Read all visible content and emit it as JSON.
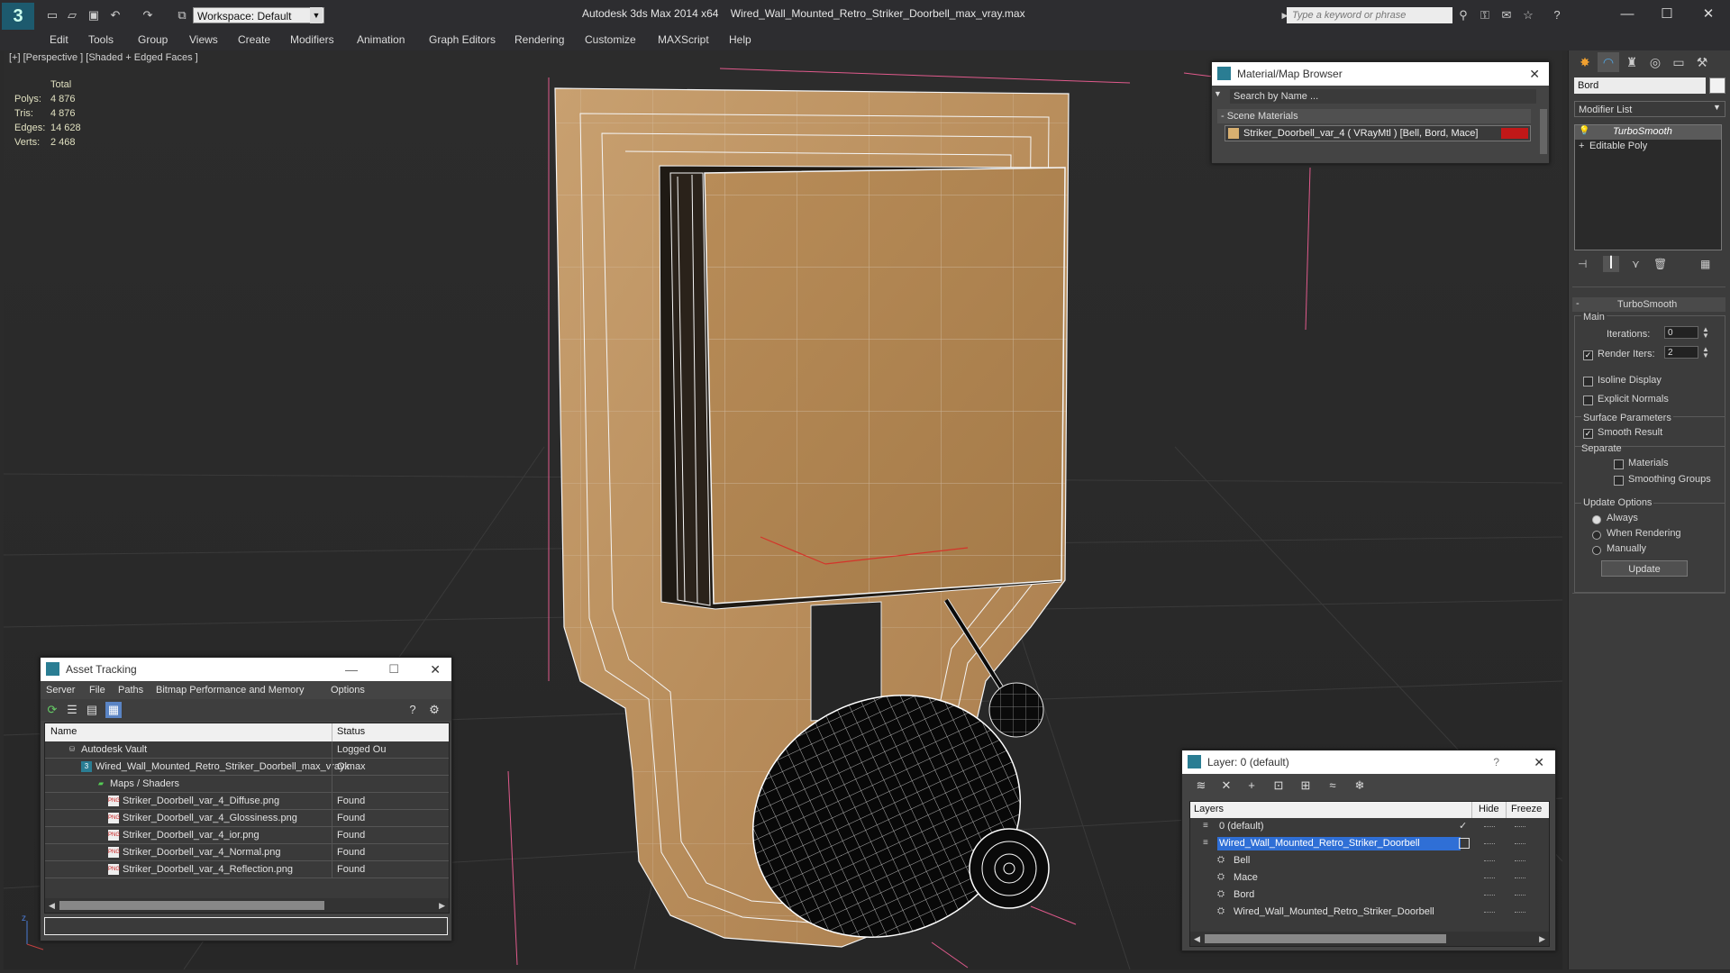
{
  "titlebar": {
    "app_title": "Autodesk 3ds Max  2014 x64",
    "file_name": "Wired_Wall_Mounted_Retro_Striker_Doorbell_max_vray.max",
    "workspace": "Workspace: Default",
    "search_placeholder": "Type a keyword or phrase"
  },
  "menu": [
    "Edit",
    "Tools",
    "Group",
    "Views",
    "Create",
    "Modifiers",
    "Animation",
    "Graph Editors",
    "Rendering",
    "Customize",
    "MAXScript",
    "Help"
  ],
  "viewport": {
    "label": "[+] [Perspective ] [Shaded + Edged Faces ]",
    "stats_header": "Total",
    "stats": [
      {
        "label": "Polys:",
        "value": "4 876"
      },
      {
        "label": "Tris:",
        "value": "4 876"
      },
      {
        "label": "Edges:",
        "value": "14 628"
      },
      {
        "label": "Verts:",
        "value": "2 468"
      }
    ],
    "axis_z": "z"
  },
  "material_browser": {
    "title": "Material/Map Browser",
    "search_placeholder": "Search by Name ...",
    "section": "- Scene Materials",
    "material": "Striker_Doorbell_var_4  ( VRayMtl )  [Bell, Bord, Mace]",
    "material_color": "#c01818"
  },
  "asset_tracking": {
    "title": "Asset Tracking",
    "menu": [
      "Server",
      "File",
      "Paths",
      "Bitmap Performance and Memory",
      "Options"
    ],
    "columns": [
      "Name",
      "Status"
    ],
    "rows": [
      {
        "name": "Autodesk Vault",
        "status": "Logged Ou",
        "indent": 0
      },
      {
        "name": "Wired_Wall_Mounted_Retro_Striker_Doorbell_max_vray.max",
        "status": "Ok",
        "indent": 1
      },
      {
        "name": "Maps / Shaders",
        "status": "",
        "indent": 2
      },
      {
        "name": "Striker_Doorbell_var_4_Diffuse.png",
        "status": "Found",
        "indent": 3
      },
      {
        "name": "Striker_Doorbell_var_4_Glossiness.png",
        "status": "Found",
        "indent": 3
      },
      {
        "name": "Striker_Doorbell_var_4_ior.png",
        "status": "Found",
        "indent": 3
      },
      {
        "name": "Striker_Doorbell_var_4_Normal.png",
        "status": "Found",
        "indent": 3
      },
      {
        "name": "Striker_Doorbell_var_4_Reflection.png",
        "status": "Found",
        "indent": 3
      }
    ]
  },
  "layer_manager": {
    "title": "Layer: 0 (default)",
    "help": "?",
    "columns": [
      "Layers",
      "Hide",
      "Freeze"
    ],
    "rows": [
      {
        "name": "0 (default)",
        "indent": 0,
        "selected": false
      },
      {
        "name": "Wired_Wall_Mounted_Retro_Striker_Doorbell",
        "indent": 0,
        "selected": true
      },
      {
        "name": "Bell",
        "indent": 1,
        "selected": false
      },
      {
        "name": "Mace",
        "indent": 1,
        "selected": false
      },
      {
        "name": "Bord",
        "indent": 1,
        "selected": false
      },
      {
        "name": "Wired_Wall_Mounted_Retro_Striker_Doorbell",
        "indent": 1,
        "selected": false
      }
    ]
  },
  "command_panel": {
    "object_name": "Bord",
    "object_color": "#f2f2f2",
    "modifier_list": "Modifier List",
    "stack": [
      "TurboSmooth",
      "Editable Poly"
    ],
    "rollout_title": "TurboSmooth",
    "main_label": "Main",
    "iterations_label": "Iterations:",
    "iterations_value": "0",
    "render_iters_label": "Render Iters:",
    "render_iters_value": "2",
    "isoline": "Isoline Display",
    "explicit_normals": "Explicit Normals",
    "surface_params": "Surface Parameters",
    "smooth_result": "Smooth Result",
    "separate": "Separate",
    "materials": "Materials",
    "smoothing_groups": "Smoothing Groups",
    "update_options": "Update Options",
    "always": "Always",
    "when_rendering": "When Rendering",
    "manually": "Manually",
    "update_button": "Update"
  }
}
